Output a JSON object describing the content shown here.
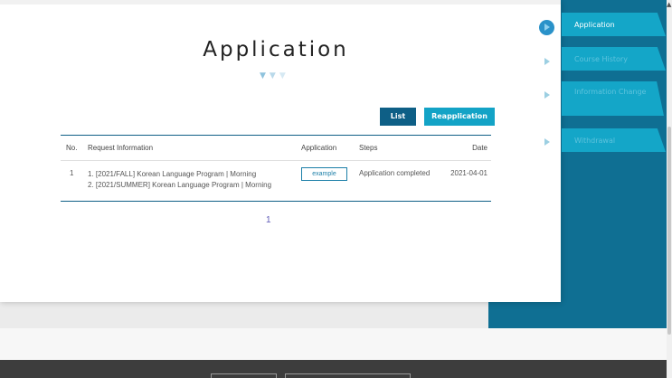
{
  "page": {
    "title": "Application"
  },
  "buttons": {
    "list": "List",
    "reapplication": "Reapplication"
  },
  "table": {
    "headers": {
      "no": "No.",
      "request": "Request Information",
      "application": "Application",
      "steps": "Steps",
      "date": "Date"
    },
    "rows": [
      {
        "no": "1",
        "request_line1": "1. [2021/FALL] Korean Language Program | Morning",
        "request_line2": "2. [2021/SUMMER] Korean Language Program | Morning",
        "application": "example",
        "steps": "Application completed",
        "date": "2021-04-01"
      }
    ]
  },
  "pagination": {
    "current": "1"
  },
  "side_menu": {
    "items": [
      {
        "label": "Application",
        "active": true
      },
      {
        "label": "Course History",
        "active": false
      },
      {
        "label": "Information Change",
        "active": false
      },
      {
        "label": "Withdrawal",
        "active": false
      }
    ]
  },
  "colors": {
    "primary_dark": "#0e5f86",
    "accent": "#13a3c6",
    "side_panel": "#0f6f93",
    "footer": "#3d3d3d"
  },
  "icons": {
    "menu_marker": "play-circle-icon",
    "title_decoration": "chevron-down-icon"
  }
}
